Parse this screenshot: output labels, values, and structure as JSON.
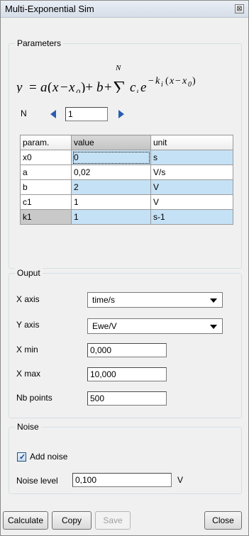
{
  "window": {
    "title": "Multi-Exponential Sim",
    "close_glyph": "⊠"
  },
  "parameters": {
    "legend": "Parameters",
    "n_label": "N",
    "n_value": "1",
    "table": {
      "headers": [
        "param.",
        "value",
        "unit"
      ],
      "rows": [
        {
          "param": "x0",
          "value": "0",
          "unit": "s"
        },
        {
          "param": "a",
          "value": "0,02",
          "unit": "V/s"
        },
        {
          "param": "b",
          "value": "2",
          "unit": "V"
        },
        {
          "param": "c1",
          "value": "1",
          "unit": "V"
        },
        {
          "param": "k1",
          "value": "1",
          "unit": "s-1"
        }
      ]
    }
  },
  "output": {
    "legend": "Ouput",
    "x_axis_label": "X axis",
    "x_axis_value": "time/s",
    "y_axis_label": "Y axis",
    "y_axis_value": "Ewe/V",
    "x_min_label": "X min",
    "x_min_value": "0,000",
    "x_max_label": "X max",
    "x_max_value": "10,000",
    "nb_points_label": "Nb points",
    "nb_points_value": "500"
  },
  "noise": {
    "legend": "Noise",
    "add_noise_label": "Add noise",
    "add_noise_checked": true,
    "noise_level_label": "Noise level",
    "noise_level_value": "0,100",
    "noise_level_unit": "V"
  },
  "buttons": {
    "calculate": "Calculate",
    "copy": "Copy",
    "save": "Save",
    "close": "Close"
  },
  "colors": {
    "selected_row": "#c5e1f5",
    "arrow": "#2a5db0"
  }
}
